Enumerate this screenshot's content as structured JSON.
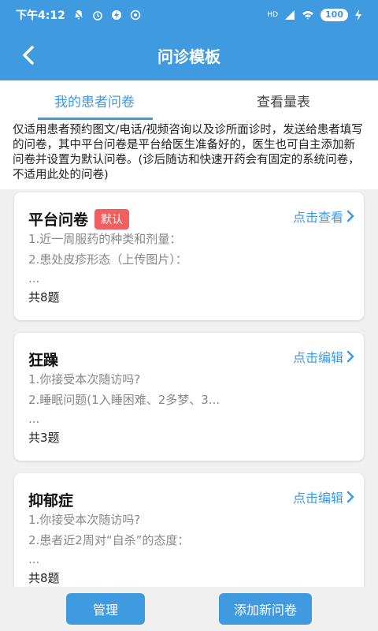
{
  "status_bar": {
    "time": "下午4:12",
    "battery": "100",
    "network": "HD"
  },
  "header": {
    "title": "问诊模板",
    "back_icon": "chevron-left-icon"
  },
  "tabs": [
    {
      "label": "我的患者问卷",
      "active": true
    },
    {
      "label": "查看量表",
      "active": false
    }
  ],
  "notice": "仅适用患者预约图文/电话/视频咨询以及诊所面诊时，发送给患者填写的问卷，其中平台问卷是平台给医生准备好的，医生也可自主添加新问卷并设置为默认问卷。(诊后随访和快速开药会有固定的系统问卷，不适用此处的问卷)",
  "cards": [
    {
      "title": "平台问卷",
      "badge": "默认",
      "action": "点击查看",
      "lines": [
        "1.近一周服药的种类和剂量：",
        "2.患处皮疹形态（上传图片）：",
        "..."
      ],
      "count": "共8题"
    },
    {
      "title": "狂躁",
      "badge": "",
      "action": "点击编辑",
      "lines": [
        "1.你接受本次随访吗?",
        "2.睡眠问题(1入睡困难、2多梦、3...",
        "..."
      ],
      "count": "共3题"
    },
    {
      "title": "抑郁症",
      "badge": "",
      "action": "点击编辑",
      "lines": [
        "1.你接受本次随访吗?",
        "2.患者近2周对“自杀”的态度：",
        "..."
      ],
      "count": "共8题"
    }
  ],
  "buttons": {
    "manage": "管理",
    "add": "添加新问卷"
  },
  "colors": {
    "primary": "#3f9ae0",
    "badge": "#f06060"
  }
}
